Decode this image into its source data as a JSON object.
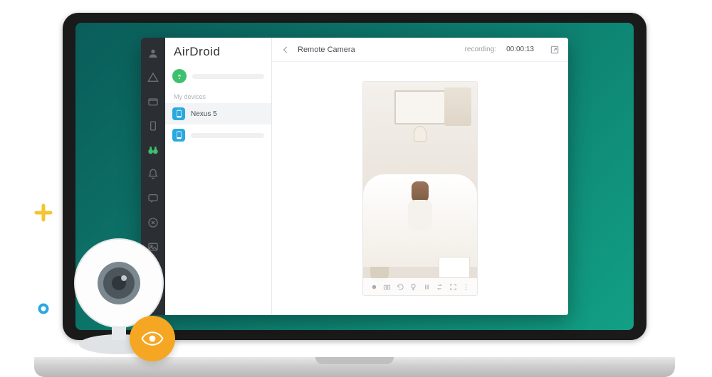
{
  "app": {
    "name_a": "Air",
    "name_b": "Droid"
  },
  "sidebar": {
    "section_label": "My devices",
    "devices": [
      {
        "name": "Nexus 5"
      },
      {
        "name": ""
      }
    ]
  },
  "topbar": {
    "title": "Remote Camera",
    "recording_label": "recording:",
    "recording_time": "00:00:13"
  },
  "controls": {
    "items": [
      "record",
      "camera",
      "rotate",
      "light",
      "pause",
      "swap",
      "fullscreen",
      "more"
    ]
  }
}
